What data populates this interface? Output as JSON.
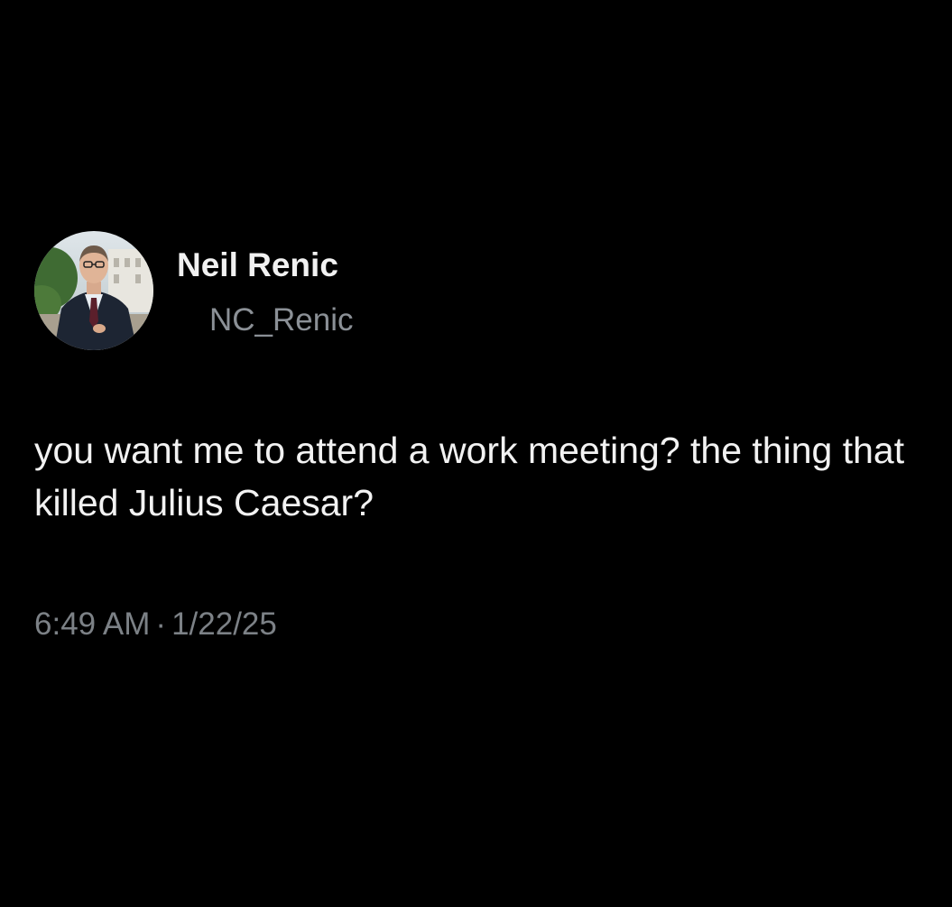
{
  "tweet": {
    "author": {
      "display_name": "Neil Renic",
      "handle": "NC_Renic",
      "avatar_icon": "profile-photo"
    },
    "text": "you want me to attend a work meeting? the thing that killed Julius Caesar?",
    "time": "6:49 AM",
    "separator": "·",
    "date": "1/22/25"
  },
  "colors": {
    "background": "#000000",
    "name": "#f1f1f1",
    "handle": "#8b9096",
    "body": "#f2f2f2",
    "meta": "#7c8186"
  }
}
